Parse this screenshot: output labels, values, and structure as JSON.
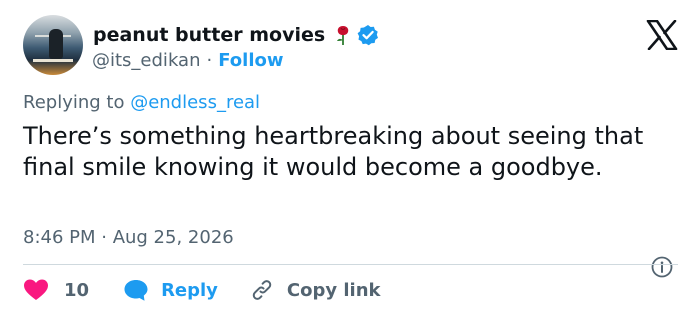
{
  "user": {
    "display_name": "peanut butter movies",
    "handle": "@its_edikan",
    "separator": "·",
    "follow_label": "Follow"
  },
  "reply_context": {
    "prefix": "Replying to ",
    "mention": "@endless_real"
  },
  "tweet": {
    "text": "There’s something heartbreaking about seeing that final smile knowing it would become a goodbye.",
    "timestamp": "8:46 PM · Aug 25, 2026"
  },
  "actions": {
    "like_count": "10",
    "reply_label": "Reply",
    "copy_label": "Copy link"
  },
  "colors": {
    "accent": "#1d9bf0",
    "like": "#f91880",
    "text_secondary": "#536471",
    "divider": "#cfd9de"
  },
  "icons": [
    "rose-icon",
    "verified-icon",
    "x-logo-icon",
    "info-icon",
    "heart-icon",
    "reply-icon",
    "link-icon"
  ]
}
